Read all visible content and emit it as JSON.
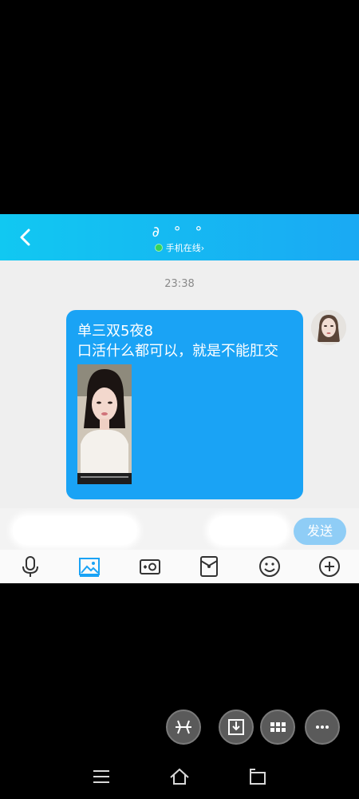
{
  "header": {
    "title": "∂ ° °",
    "status_text": "手机在线",
    "status_chevron": "›",
    "back_icon": "chevron-left-icon"
  },
  "chat": {
    "timestamp": "23:38",
    "message": {
      "line1": "单三双5夜8",
      "line2": "口活什么都可以，就是不能肛交",
      "attachment": "video-thumbnail"
    }
  },
  "input": {
    "send_label": "发送"
  },
  "toolbar": {
    "icons": [
      "microphone-icon",
      "image-icon",
      "camera-icon",
      "red-packet-icon",
      "emoji-icon",
      "plus-icon"
    ]
  },
  "floating": {
    "icons": [
      "pinwheel-icon",
      "download-icon",
      "grid-icon",
      "more-icon"
    ]
  },
  "nav": {
    "icons": [
      "menu-icon",
      "home-icon",
      "back-icon"
    ]
  },
  "colors": {
    "header": "#1aa9f3",
    "bubble": "#1aa3f5",
    "send": "#8fcdf6",
    "chat_bg": "#efefef"
  }
}
